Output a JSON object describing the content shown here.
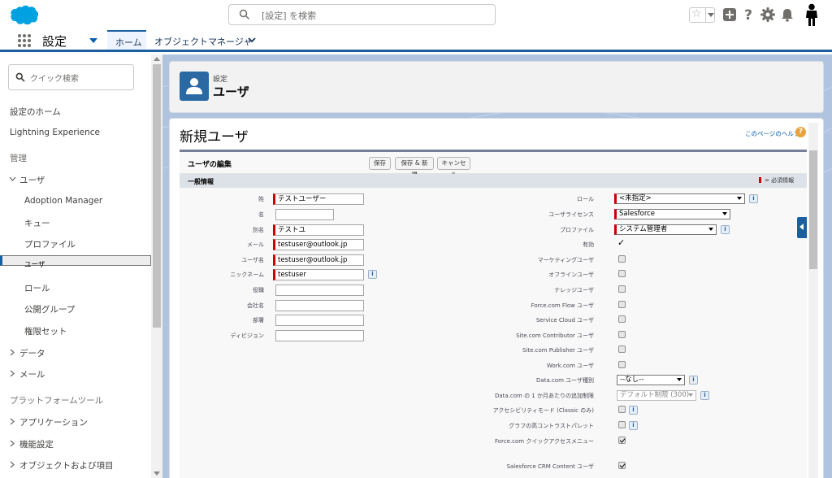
{
  "global_search": {
    "placeholder": "[設定] を検索"
  },
  "context_bar": {
    "app_name": "設定",
    "tab_home": "ホーム",
    "tab_object_manager": "オブジェクトマネージャ"
  },
  "sidebar": {
    "quick_find_placeholder": "クイック検索",
    "items": [
      {
        "label": "設定のホーム",
        "kind": "link"
      },
      {
        "label": "Lightning Experience",
        "kind": "link"
      },
      {
        "label": "管理",
        "kind": "heading"
      },
      {
        "label": "ユーザ",
        "kind": "expanded"
      },
      {
        "label": "Adoption Manager",
        "kind": "child"
      },
      {
        "label": "キュー",
        "kind": "child"
      },
      {
        "label": "プロファイル",
        "kind": "child"
      },
      {
        "label": "ユーザ",
        "kind": "child-selected"
      },
      {
        "label": "ロール",
        "kind": "child"
      },
      {
        "label": "公開グループ",
        "kind": "child"
      },
      {
        "label": "権限セット",
        "kind": "child"
      },
      {
        "label": "データ",
        "kind": "collapsed"
      },
      {
        "label": "メール",
        "kind": "collapsed"
      },
      {
        "label": "プラットフォームツール",
        "kind": "heading"
      },
      {
        "label": "アプリケーション",
        "kind": "collapsed"
      },
      {
        "label": "機能設定",
        "kind": "collapsed"
      },
      {
        "label": "オブジェクトおよび項目",
        "kind": "collapsed"
      }
    ]
  },
  "page_header": {
    "eyebrow": "設定",
    "title": "ユーザ"
  },
  "page": {
    "title": "新規ユーザ",
    "help_link": "このページのヘルプ",
    "help_icon_text": "?",
    "block_title": "ユーザの編集",
    "buttons": {
      "save": "保存",
      "save_new": "保存 & 新規",
      "cancel": "キャンセル"
    },
    "section_title": "一般情報",
    "required_legend": "= 必須情報",
    "info_glyph": "i",
    "checkmark_glyph": "✓"
  },
  "left_fields": [
    {
      "label": "姓",
      "value": "テストユーザー",
      "required": true
    },
    {
      "label": "名",
      "value": "",
      "required": false
    },
    {
      "label": "別名",
      "value": "テストユ",
      "required": true
    },
    {
      "label": "メール",
      "value": "testuser@outlook.jp",
      "required": true
    },
    {
      "label": "ユーザ名",
      "value": "testuser@outlook.jp",
      "required": true
    },
    {
      "label": "ニックネーム",
      "value": "testuser",
      "required": true,
      "info": true
    },
    {
      "label": "役職",
      "value": "",
      "required": false
    },
    {
      "label": "会社名",
      "value": "",
      "required": false
    },
    {
      "label": "部署",
      "value": "",
      "required": false
    },
    {
      "label": "ディビジョン",
      "value": "",
      "required": false
    }
  ],
  "right_fields": [
    {
      "label": "ロール",
      "type": "select",
      "value": "<未指定>",
      "required": true,
      "info": true
    },
    {
      "label": "ユーザライセンス",
      "type": "select",
      "value": "Salesforce",
      "required": true
    },
    {
      "label": "プロファイル",
      "type": "select",
      "value": "システム管理者",
      "required": true,
      "info": true
    },
    {
      "label": "有効",
      "type": "check",
      "checked": true
    },
    {
      "label": "マーケティングユーザ",
      "type": "checkbox",
      "checked": false
    },
    {
      "label": "オフラインユーザ",
      "type": "checkbox",
      "checked": false
    },
    {
      "label": "ナレッジユーザ",
      "type": "checkbox",
      "checked": false
    },
    {
      "label": "Force.com Flow ユーザ",
      "type": "checkbox",
      "checked": false
    },
    {
      "label": "Service Cloud ユーザ",
      "type": "checkbox",
      "checked": false
    },
    {
      "label": "Site.com Contributor ユーザ",
      "type": "checkbox",
      "checked": false
    },
    {
      "label": "Site.com Publisher ユーザ",
      "type": "checkbox",
      "checked": false
    },
    {
      "label": "Work.com ユーザ",
      "type": "checkbox",
      "checked": false
    },
    {
      "label": "Data.com ユーザ種別",
      "type": "select",
      "value": "--なし--",
      "info": true
    },
    {
      "label": "Data.com の 1 か月あたりの追加制限",
      "type": "select",
      "value": "デフォルト制限 (300)",
      "disabled": true,
      "info": true
    },
    {
      "label": "アクセシビリティモード (Classic のみ)",
      "type": "checkbox",
      "checked": false,
      "info": true
    },
    {
      "label": "グラフの高コントラストパレット",
      "type": "checkbox",
      "checked": false,
      "info": true
    },
    {
      "label": "Force.com クイックアクセスメニュー",
      "type": "checkbox",
      "checked": true
    },
    {
      "label": "Salesforce CRM Content ユーザ",
      "type": "checkbox",
      "checked": true
    }
  ],
  "colors": {
    "brand_blue": "#1b5f9e",
    "required_red": "#cc0000",
    "salesforce_cloud": "#00a1e0"
  }
}
